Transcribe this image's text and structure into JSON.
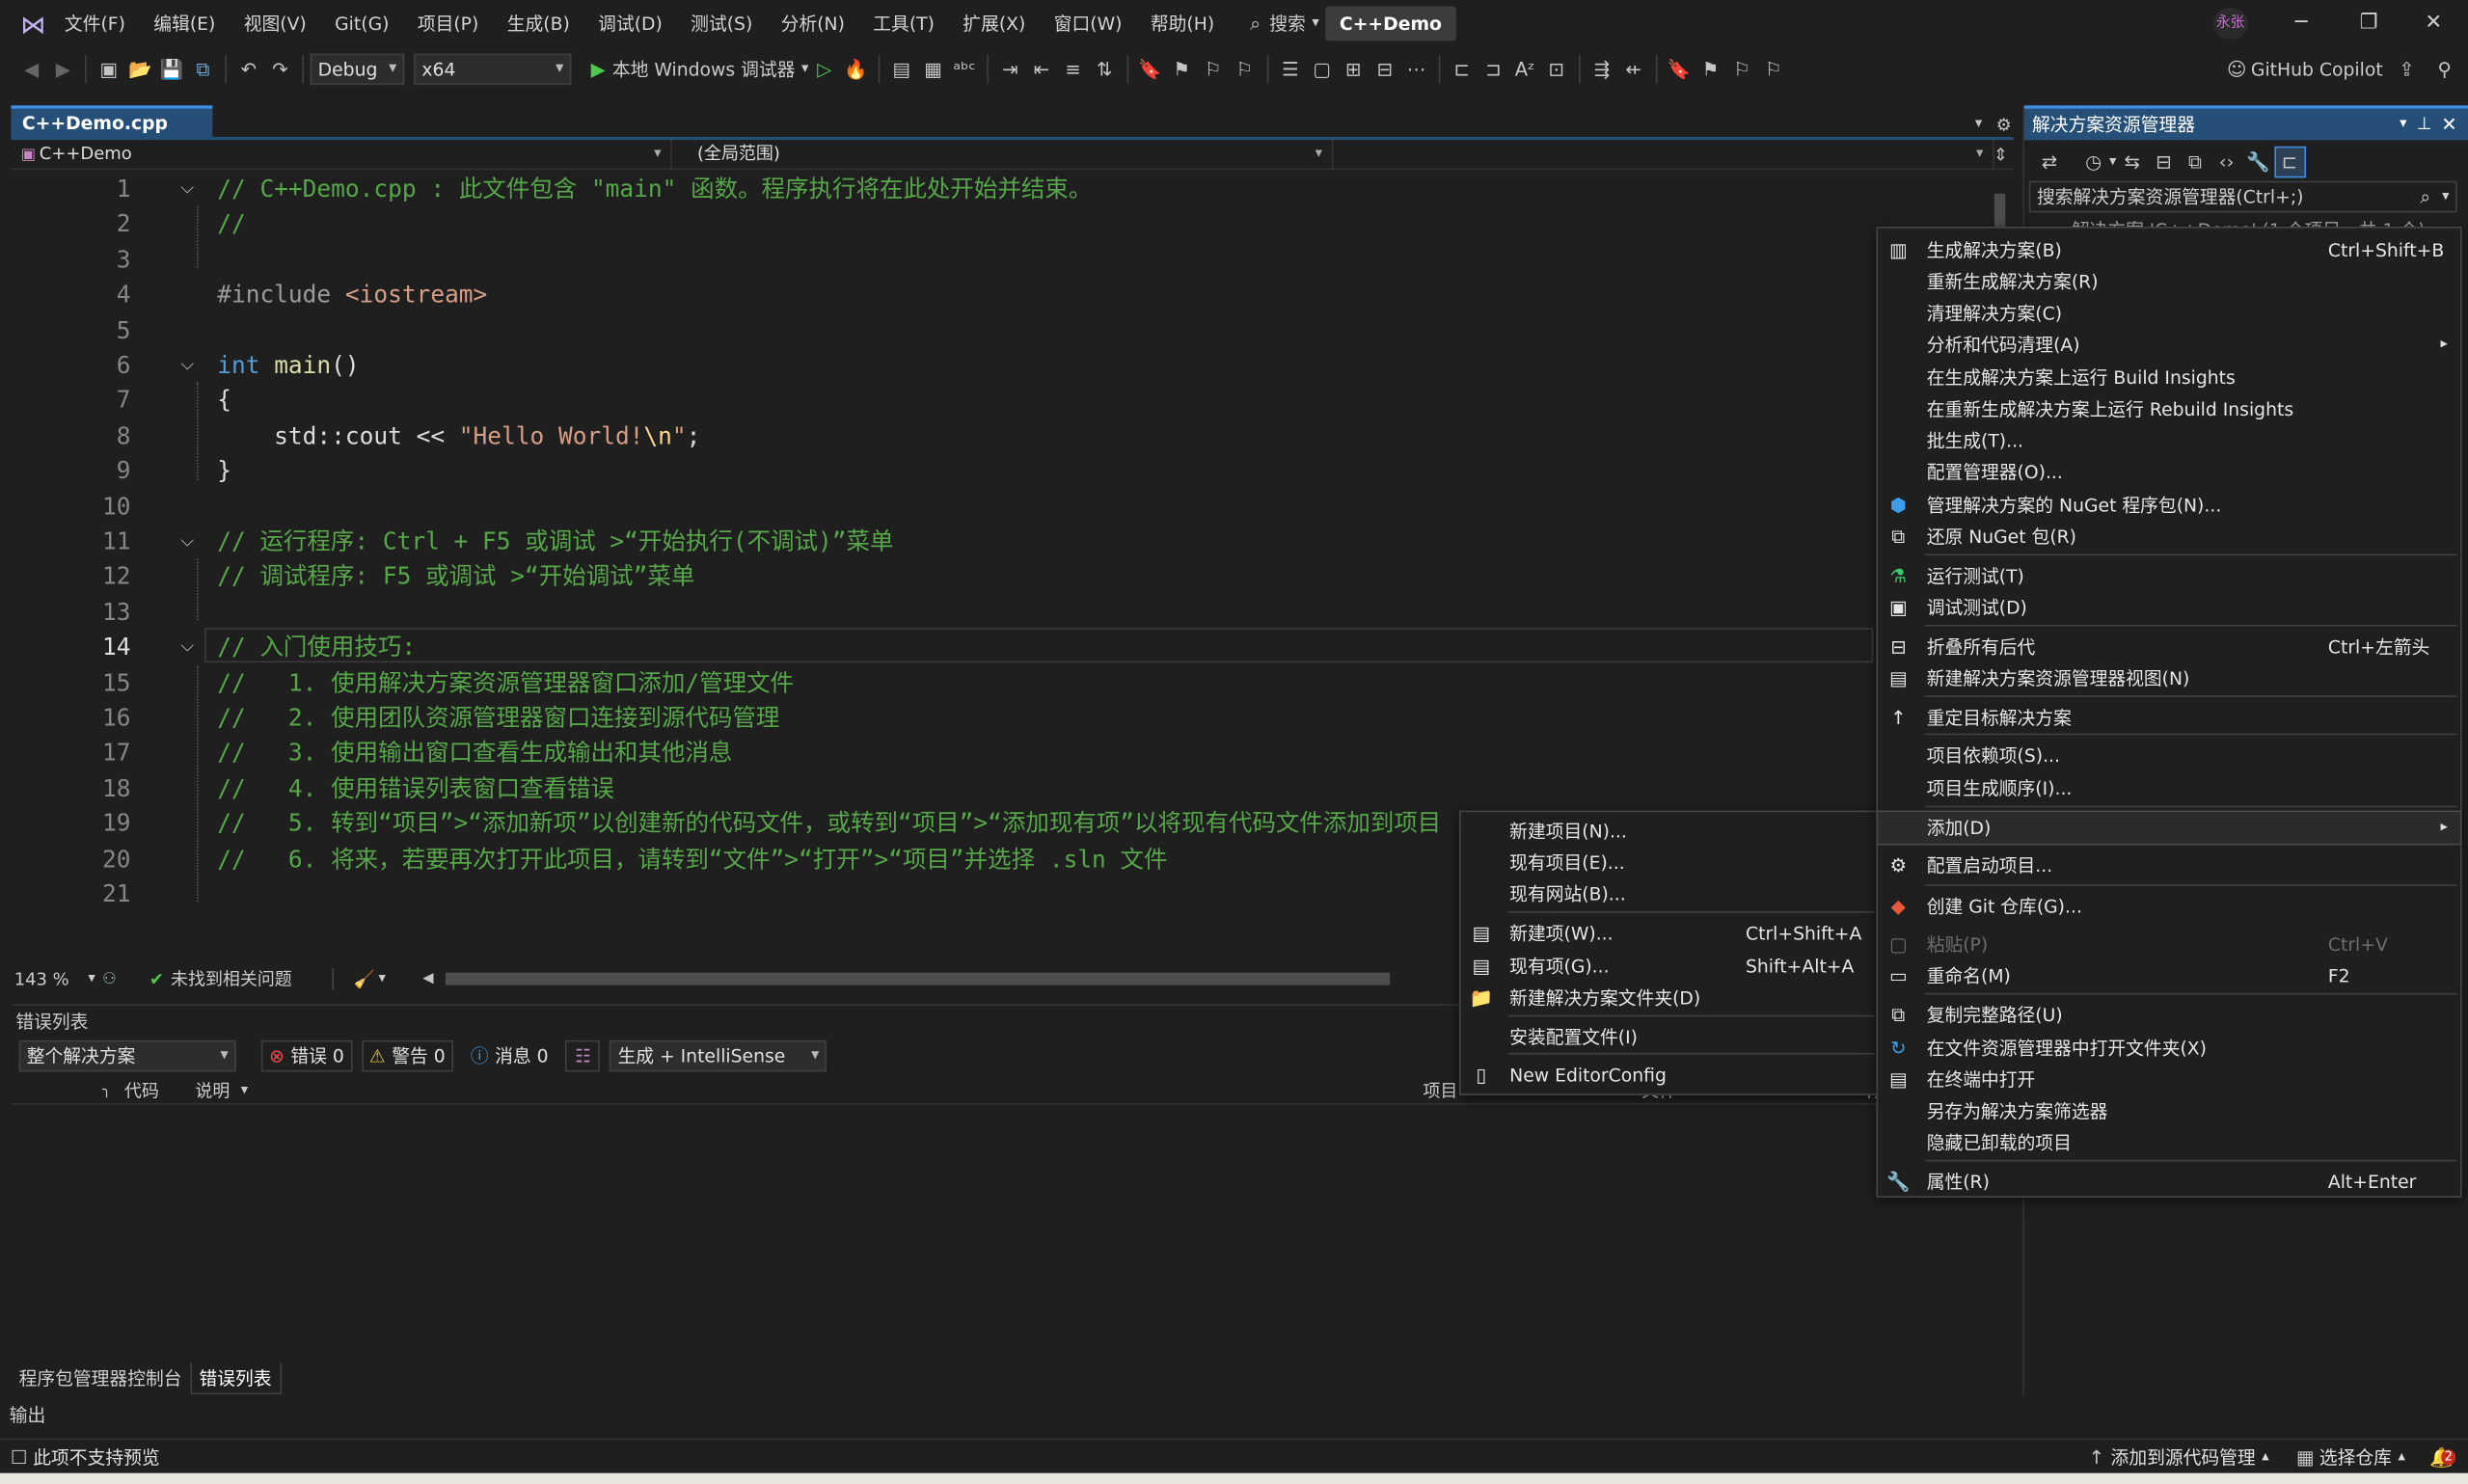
{
  "menubar": {
    "items": [
      "文件(F)",
      "编辑(E)",
      "视图(V)",
      "Git(G)",
      "项目(P)",
      "生成(B)",
      "调试(D)",
      "测试(S)",
      "分析(N)",
      "工具(T)",
      "扩展(X)",
      "窗口(W)",
      "帮助(H)"
    ],
    "search_label": "搜索",
    "solution_name": "C++Demo",
    "avatar_initials": "永张"
  },
  "toolbar": {
    "configuration": "Debug",
    "platform": "x64",
    "run_target": "本地 Windows 调试器",
    "copilot_label": "GitHub Copilot"
  },
  "editor": {
    "tab_title": "C++Demo.cpp",
    "nav_project": "C++Demo",
    "nav_scope": "(全局范围)",
    "current_line": 14,
    "lines": [
      {
        "n": "1",
        "text": "// C++Demo.cpp : 此文件包含 \"main\" 函数。程序执行将在此处开始并结束。"
      },
      {
        "n": "2",
        "text": "//"
      },
      {
        "n": "3",
        "text": ""
      },
      {
        "n": "4",
        "text": "#include <iostream>"
      },
      {
        "n": "5",
        "text": ""
      },
      {
        "n": "6",
        "text": "int main()"
      },
      {
        "n": "7",
        "text": "{"
      },
      {
        "n": "8",
        "text": "    std::cout << \"Hello World!\\n\";"
      },
      {
        "n": "9",
        "text": "}"
      },
      {
        "n": "10",
        "text": ""
      },
      {
        "n": "11",
        "text": "// 运行程序: Ctrl + F5 或调试 >“开始执行(不调试)”菜单"
      },
      {
        "n": "12",
        "text": "// 调试程序: F5 或调试 >“开始调试”菜单"
      },
      {
        "n": "13",
        "text": ""
      },
      {
        "n": "14",
        "text": "// 入门使用技巧: "
      },
      {
        "n": "15",
        "text": "//   1. 使用解决方案资源管理器窗口添加/管理文件"
      },
      {
        "n": "16",
        "text": "//   2. 使用团队资源管理器窗口连接到源代码管理"
      },
      {
        "n": "17",
        "text": "//   3. 使用输出窗口查看生成输出和其他消息"
      },
      {
        "n": "18",
        "text": "//   4. 使用错误列表窗口查看错误"
      },
      {
        "n": "19",
        "text": "//   5. 转到“项目”>“添加新项”以创建新的代码文件，或转到“项目”>“添加现有项”以将现有代码文件添加到项目"
      },
      {
        "n": "20",
        "text": "//   6. 将来，若要再次打开此项目，请转到“文件”>“打开”>“项目”并选择 .sln 文件"
      },
      {
        "n": "21",
        "text": ""
      }
    ],
    "zoom": "143 %",
    "issues": "未找到相关问题"
  },
  "error_list": {
    "title": "错误列表",
    "scope": "整个解决方案",
    "errors": "错误 0",
    "warnings": "警告 0",
    "messages": "消息 0",
    "source": "生成 + IntelliSense",
    "col_code": "代码",
    "col_desc": "说明",
    "col_project": "项目",
    "col_file": "文件",
    "col_line": "行"
  },
  "bottom_tabs": [
    "程序包管理器控制台",
    "错误列表"
  ],
  "output_label": "输出",
  "statusbar": {
    "left": "此项不支持预览",
    "source_control": "添加到源代码管理",
    "repo": "选择仓库",
    "notifications": "2"
  },
  "solution_explorer": {
    "title": "解决方案资源管理器",
    "search_placeholder": "搜索解决方案资源管理器(Ctrl+;)",
    "root_item": "解决方案 'C++Demo' (1 个项目，共 1 个)"
  },
  "context_menu": [
    {
      "label": "生成解决方案(B)",
      "shortcut": "Ctrl+Shift+B",
      "icon": "build-icon"
    },
    {
      "label": "重新生成解决方案(R)",
      "shortcut": ""
    },
    {
      "label": "清理解决方案(C)",
      "shortcut": ""
    },
    {
      "label": "分析和代码清理(A)",
      "shortcut": "",
      "submenu": true
    },
    {
      "label": "在生成解决方案上运行 Build Insights",
      "shortcut": ""
    },
    {
      "label": "在重新生成解决方案上运行 Rebuild Insights",
      "shortcut": ""
    },
    {
      "label": "批生成(T)...",
      "shortcut": ""
    },
    {
      "label": "配置管理器(O)...",
      "shortcut": ""
    },
    {
      "label": "管理解决方案的 NuGet 程序包(N)...",
      "shortcut": "",
      "icon": "nuget-icon"
    },
    {
      "label": "还原 NuGet 包(R)",
      "shortcut": "",
      "icon": "restore-icon"
    },
    {
      "label": "运行测试(T)",
      "shortcut": "",
      "icon": "flask-icon"
    },
    {
      "label": "调试测试(D)",
      "shortcut": "",
      "icon": "debug-test-icon"
    },
    {
      "label": "折叠所有后代",
      "shortcut": "Ctrl+左箭头",
      "icon": "collapse-icon"
    },
    {
      "label": "新建解决方案资源管理器视图(N)",
      "shortcut": "",
      "icon": "new-view-icon"
    },
    {
      "label": "重定目标解决方案",
      "shortcut": "",
      "icon": "retarget-icon"
    },
    {
      "label": "项目依赖项(S)...",
      "shortcut": ""
    },
    {
      "label": "项目生成顺序(I)...",
      "shortcut": ""
    },
    {
      "label": "添加(D)",
      "shortcut": "",
      "submenu": true,
      "highlighted": true
    },
    {
      "label": "配置启动项目...",
      "shortcut": "",
      "icon": "gear-icon"
    },
    {
      "label": "创建 Git 仓库(G)...",
      "shortcut": "",
      "icon": "git-icon"
    },
    {
      "label": "粘贴(P)",
      "shortcut": "Ctrl+V",
      "disabled": true,
      "icon": "paste-icon"
    },
    {
      "label": "重命名(M)",
      "shortcut": "F2",
      "icon": "rename-icon"
    },
    {
      "label": "复制完整路径(U)",
      "shortcut": "",
      "icon": "copy-icon"
    },
    {
      "label": "在文件资源管理器中打开文件夹(X)",
      "shortcut": "",
      "icon": "open-folder-icon"
    },
    {
      "label": "在终端中打开",
      "shortcut": "",
      "icon": "terminal-icon"
    },
    {
      "label": "另存为解决方案筛选器",
      "shortcut": ""
    },
    {
      "label": "隐藏已卸载的项目",
      "shortcut": ""
    },
    {
      "label": "属性(R)",
      "shortcut": "Alt+Enter",
      "icon": "wrench-icon"
    }
  ],
  "add_submenu": [
    {
      "label": "新建项目(N)...",
      "shortcut": ""
    },
    {
      "label": "现有项目(E)...",
      "shortcut": ""
    },
    {
      "label": "现有网站(B)...",
      "shortcut": ""
    },
    {
      "label": "新建项(W)...",
      "shortcut": "Ctrl+Shift+A",
      "icon": "new-item-icon"
    },
    {
      "label": "现有项(G)...",
      "shortcut": "Shift+Alt+A",
      "icon": "existing-item-icon"
    },
    {
      "label": "新建解决方案文件夹(D)",
      "shortcut": "",
      "icon": "folder-icon"
    },
    {
      "label": "安装配置文件(I)",
      "shortcut": ""
    },
    {
      "label": "New EditorConfig",
      "shortcut": "",
      "icon": "editorconfig-icon"
    }
  ],
  "colors": {
    "background": "#1f1f1f",
    "accent": "#264f78",
    "comment": "#57a64a",
    "keyword": "#569cd6",
    "string": "#d69d85"
  }
}
